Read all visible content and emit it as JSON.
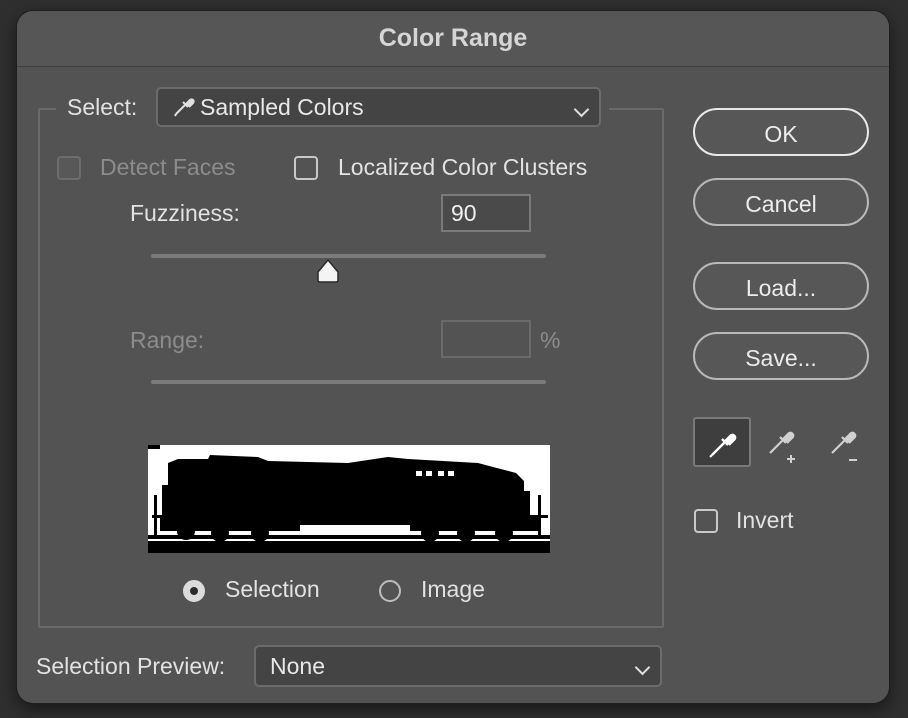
{
  "window": {
    "title": "Color Range"
  },
  "select": {
    "label": "Select:",
    "value": "Sampled Colors"
  },
  "options": {
    "detect_faces_label": "Detect Faces",
    "detect_faces_checked": false,
    "detect_faces_enabled": false,
    "localized_label": "Localized Color Clusters",
    "localized_checked": false
  },
  "fuzziness": {
    "label": "Fuzziness:",
    "value": "90",
    "slider_fraction": 0.45
  },
  "range": {
    "label": "Range:",
    "value": "",
    "unit": "%",
    "enabled": false
  },
  "preview_mode": {
    "selection_label": "Selection",
    "image_label": "Image",
    "selected": "Selection"
  },
  "selection_preview": {
    "label": "Selection Preview:",
    "value": "None"
  },
  "buttons": {
    "ok": "OK",
    "cancel": "Cancel",
    "load": "Load...",
    "save": "Save..."
  },
  "tools": [
    {
      "name": "eyedropper-icon",
      "active": true
    },
    {
      "name": "eyedropper-plus-icon",
      "active": false
    },
    {
      "name": "eyedropper-minus-icon",
      "active": false
    }
  ],
  "invert": {
    "label": "Invert",
    "checked": false
  },
  "colors": {
    "dialog_bg": "#535353",
    "selection_fg": "#000000",
    "selection_bg": "#ffffff"
  }
}
